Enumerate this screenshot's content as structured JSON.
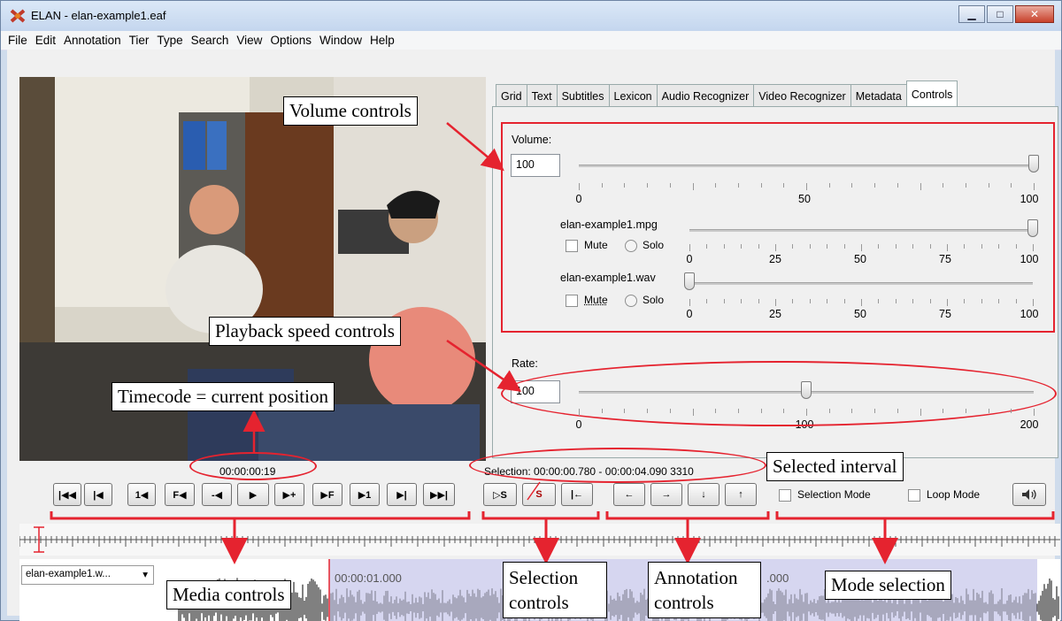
{
  "window": {
    "title": "ELAN - elan-example1.eaf",
    "min": "▁",
    "max": "□",
    "close": "✕"
  },
  "menu": [
    "File",
    "Edit",
    "Annotation",
    "Tier",
    "Type",
    "Search",
    "View",
    "Options",
    "Window",
    "Help"
  ],
  "tabs": [
    "Grid",
    "Text",
    "Subtitles",
    "Lexicon",
    "Audio Recognizer",
    "Video Recognizer",
    "Metadata",
    "Controls"
  ],
  "active_tab": "Controls",
  "volume": {
    "label": "Volume:",
    "value": "100",
    "level": 100,
    "scale": [
      "0",
      "50",
      "100"
    ],
    "tracks": [
      {
        "name": "elan-example1.mpg",
        "mute": "Mute",
        "solo": "Solo",
        "level": 100,
        "scale": [
          "0",
          "25",
          "50",
          "75",
          "100"
        ]
      },
      {
        "name": "elan-example1.wav",
        "mute": "Mute",
        "solo": "Solo",
        "level": 0,
        "scale": [
          "0",
          "25",
          "50",
          "75",
          "100"
        ]
      }
    ]
  },
  "rate": {
    "label": "Rate:",
    "value": "100",
    "level": 100,
    "scale": [
      "0",
      "100",
      "200"
    ]
  },
  "timecode": "00:00:00:19",
  "selection": "Selection: 00:00:00.780 - 00:00:04.090  3310",
  "media_buttons": [
    "|◀◀",
    "|◀",
    "1◀",
    "F◀",
    "-◀",
    "▶",
    "▶+",
    "▶F",
    "▶1",
    "▶|",
    "▶▶|"
  ],
  "selection_buttons": [
    "▷S",
    "S",
    "|←"
  ],
  "annotation_buttons": [
    "←",
    "→",
    "↓",
    "↑"
  ],
  "modes": {
    "selection_mode": "Selection Mode",
    "loop_mode": "Loop Mode"
  },
  "tier_select": "elan-example1.w...",
  "waveform_time": "00:00:01.000",
  "waveform_time2": ".000",
  "callouts": {
    "volume": "Volume controls",
    "playback": "Playback speed controls",
    "timecode": "Timecode = current position",
    "selected": "Selected interval",
    "media": "Media controls",
    "selection_controls": "Selection controls",
    "annotation_controls": "Annotation controls",
    "mode": "Mode selection"
  }
}
